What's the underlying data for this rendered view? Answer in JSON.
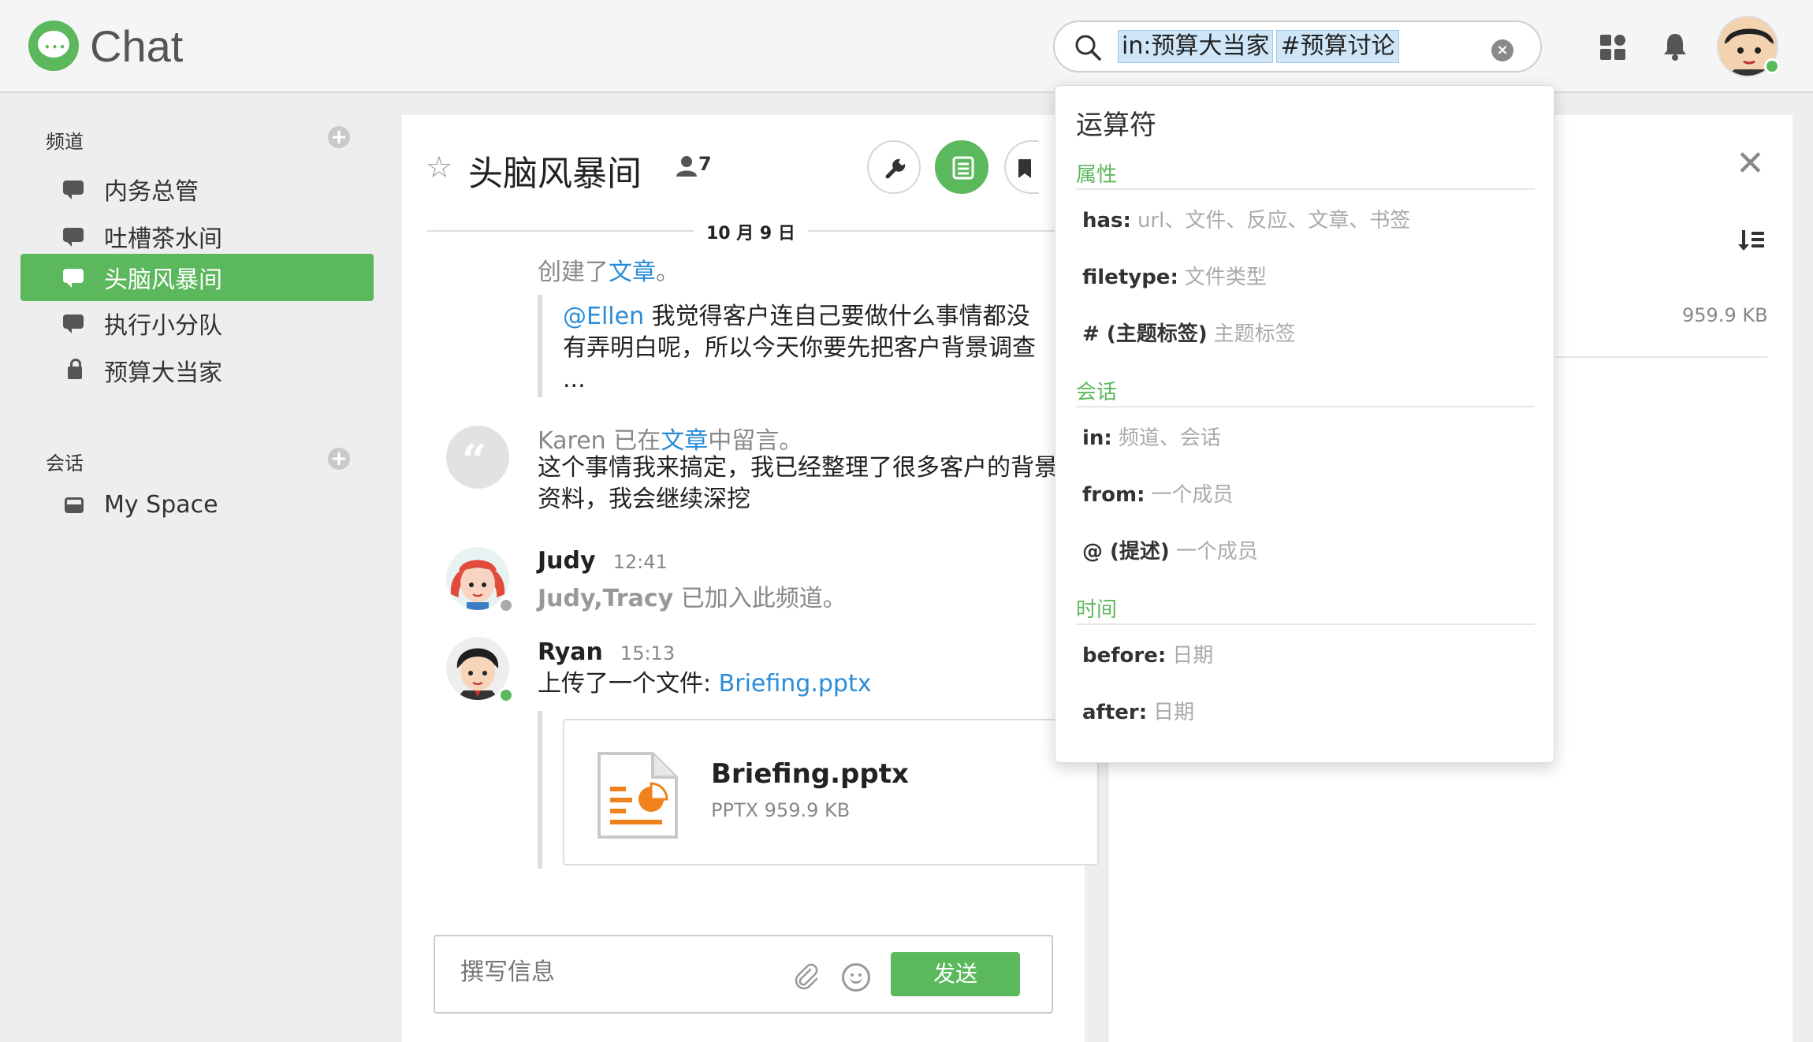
{
  "app": {
    "title": "Chat",
    "brand_color": "#5cb85c"
  },
  "search": {
    "tokens": [
      "in:预算大当家",
      "#预算讨论"
    ]
  },
  "sidebar": {
    "channels_header": "频道",
    "channels": [
      {
        "label": "内务总管",
        "icon": "chat-icon",
        "active": false
      },
      {
        "label": "吐槽茶水间",
        "icon": "chat-icon",
        "active": false
      },
      {
        "label": "头脑风暴间",
        "icon": "chat-icon",
        "active": true
      },
      {
        "label": "执行小分队",
        "icon": "chat-icon",
        "active": false
      },
      {
        "label": "预算大当家",
        "icon": "lock-icon",
        "active": false
      }
    ],
    "conversations_header": "会话",
    "conversations": [
      {
        "label": "My Space",
        "icon": "inbox-icon"
      }
    ]
  },
  "channel": {
    "title": "头脑风暴间",
    "member_count": "7",
    "date_separator": "10 月 9 日"
  },
  "messages": {
    "m1": {
      "prefix": "创建了",
      "link": "文章",
      "suffix": "。",
      "quote_mention": "@Ellen",
      "quote_line1": " 我觉得客户连自己要做什么事情都没",
      "quote_line2": "有弄明白呢，所以今天你要先把客户背景调查",
      "quote_line3": "..."
    },
    "m2": {
      "author": "Karen",
      "mid": " 已在",
      "link": "文章",
      "suffix": "中留言。",
      "line1": "这个事情我来搞定，我已经整理了很多客户的背景",
      "line2": "资料，我会继续深挖"
    },
    "m3": {
      "author": "Judy",
      "time": "12:41",
      "names": "Judy,Tracy",
      "text": " 已加入此频道。"
    },
    "m4": {
      "author": "Ryan",
      "time": "15:13",
      "text": "上传了一个文件: ",
      "link": "Briefing.pptx"
    },
    "file": {
      "name": "Briefing.pptx",
      "meta": "PPTX 959.9 KB"
    }
  },
  "composer": {
    "placeholder": "撰写信息",
    "send_label": "发送"
  },
  "right_panel": {
    "file_size": "959.9 KB"
  },
  "dropdown": {
    "title": "运算符",
    "groups": [
      {
        "label": "属性",
        "items": [
          {
            "key": "has:",
            "desc": "url、文件、反应、文章、书签"
          },
          {
            "key": "filetype:",
            "desc": "文件类型"
          },
          {
            "key": "# (主题标签)",
            "desc": "主题标签"
          }
        ]
      },
      {
        "label": "会话",
        "items": [
          {
            "key": "in:",
            "desc": "频道、会话"
          },
          {
            "key": "from:",
            "desc": "一个成员"
          },
          {
            "key": "@ (提述)",
            "desc": "一个成员"
          }
        ]
      },
      {
        "label": "时间",
        "items": [
          {
            "key": "before:",
            "desc": "日期"
          },
          {
            "key": "after:",
            "desc": "日期"
          }
        ]
      }
    ]
  }
}
